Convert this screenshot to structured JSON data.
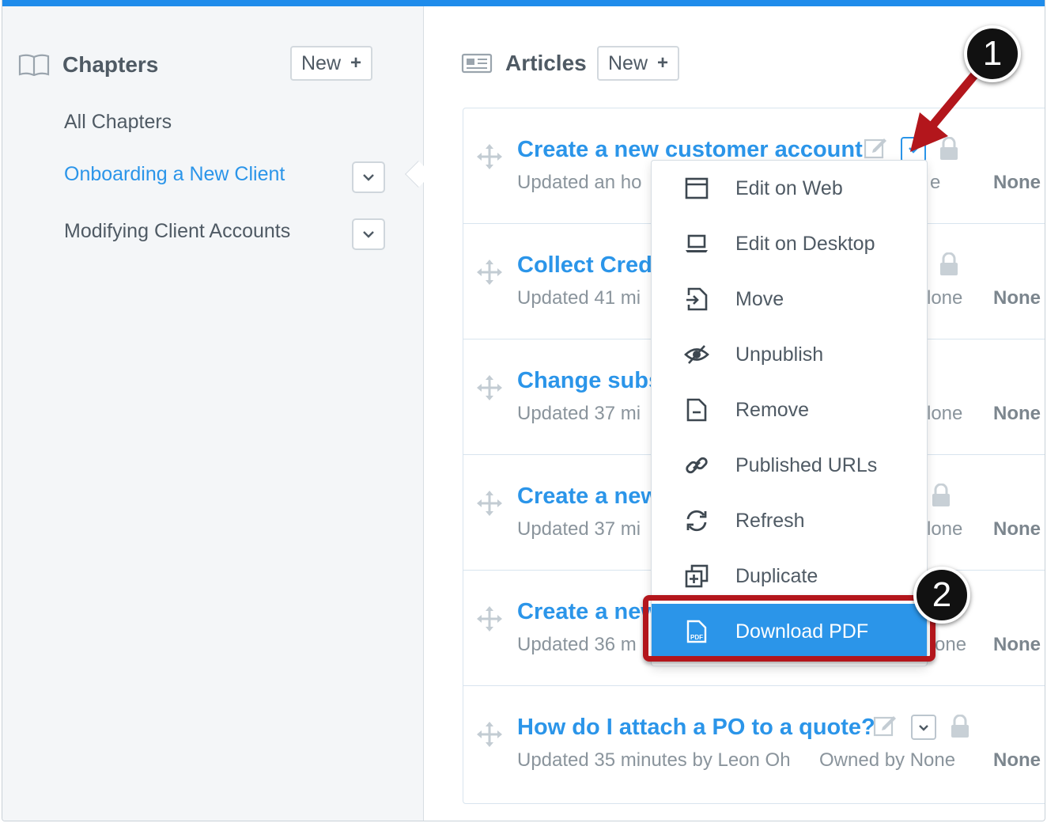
{
  "sidebar": {
    "title": "Chapters",
    "new_label": "New",
    "new_plus": "+",
    "items": [
      {
        "label": "All Chapters",
        "active": false,
        "has_dropdown": false
      },
      {
        "label": "Onboarding a New Client",
        "active": true,
        "has_dropdown": true
      },
      {
        "label": "Modifying Client Accounts",
        "active": false,
        "has_dropdown": true
      }
    ]
  },
  "main": {
    "title": "Articles",
    "new_label": "New",
    "new_plus": "+",
    "rows": [
      {
        "title": "Create a new customer account",
        "meta": "Updated an ho",
        "owner": "e",
        "status": "None"
      },
      {
        "title": "Collect Credi",
        "meta": "Updated 41 mi",
        "owner": "lone",
        "status": "None"
      },
      {
        "title": "Change subs",
        "meta": "Updated 37 mi",
        "owner": "lone",
        "status": "None"
      },
      {
        "title": "Create a new",
        "meta": "Updated 37 mi",
        "owner": "lone",
        "status": "None"
      },
      {
        "title": "Create a new",
        "meta": "Updated 36 m",
        "owner": "one",
        "status": "None"
      },
      {
        "title": "How do I attach a PO to a quote?",
        "meta": "Updated 35 minutes by Leon Oh",
        "owner": "Owned by None",
        "status": "None"
      }
    ]
  },
  "menu": {
    "items": [
      {
        "label": "Edit on Web",
        "icon": "browser-window-icon"
      },
      {
        "label": "Edit on Desktop",
        "icon": "laptop-icon"
      },
      {
        "label": "Move",
        "icon": "move-file-icon"
      },
      {
        "label": "Unpublish",
        "icon": "eye-slash-icon"
      },
      {
        "label": "Remove",
        "icon": "remove-file-icon"
      },
      {
        "label": "Published URLs",
        "icon": "link-icon"
      },
      {
        "label": "Refresh",
        "icon": "refresh-icon"
      },
      {
        "label": "Duplicate",
        "icon": "duplicate-icon"
      },
      {
        "label": "Download PDF",
        "icon": "pdf-file-icon",
        "highlighted": true
      }
    ]
  },
  "annotations": {
    "step1": "1",
    "step2": "2"
  },
  "colors": {
    "accent": "#2b95e9",
    "topbar": "#1f8ceb",
    "annotation_red": "#b3161c"
  }
}
